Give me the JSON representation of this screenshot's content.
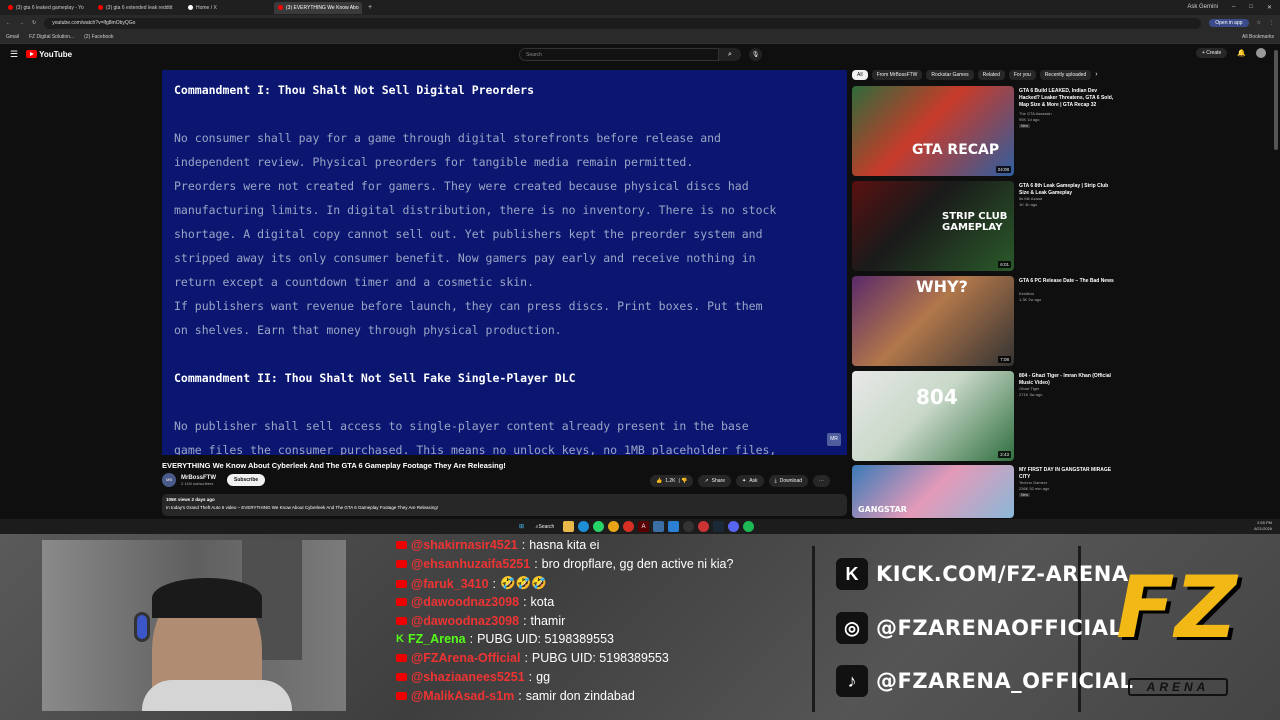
{
  "browser": {
    "tabs": [
      {
        "label": "(3) gta 6 leaked gameplay - Yo",
        "icon": "youtube-icon"
      },
      {
        "label": "(3) gta 6 extended leak redditt",
        "icon": "youtube-icon"
      },
      {
        "label": "Home / X",
        "icon": "x-icon"
      },
      {
        "label": "(3) EVERYTHING We Know Abo",
        "icon": "youtube-icon",
        "active": true
      }
    ],
    "url": "youtube.com/watch?v=lfg8mObyQGo",
    "open_in_app": "Open in app",
    "ask_gemini": "Ask Gemini",
    "bookmarks": [
      "Gmail",
      "FZ Digital Solution...",
      "(2) Facebook"
    ],
    "all_bookmarks": "All Bookmarks"
  },
  "youtube": {
    "logo": "YouTube",
    "logo_country": "PK",
    "search_placeholder": "Search",
    "create_label": "Create",
    "notif_count": "9+"
  },
  "player": {
    "lines": [
      {
        "text": "Commandment I: Thou Shalt Not Sell Digital Preorders",
        "heading": true
      },
      {
        "text": "No consumer shall pay for a game through digital storefronts before release and"
      },
      {
        "text": "independent review. Physical preorders for tangible media remain permitted."
      },
      {
        "text": "Preorders were not created for gamers. They were created because physical discs had"
      },
      {
        "text": "manufacturing limits. In digital distribution, there is no inventory. There is no stock"
      },
      {
        "text": "shortage. A digital copy cannot sell out. Yet publishers kept the preorder system and"
      },
      {
        "text": "stripped away its only consumer benefit. Now gamers pay early and receive nothing in"
      },
      {
        "text": "return except a countdown timer and a cosmetic skin."
      },
      {
        "text": "If publishers want revenue before launch, they can press discs. Print boxes. Put them"
      },
      {
        "text": "on shelves. Earn that money through physical production."
      },
      {
        "text": "Commandment II: Thou Shalt Not Sell Fake Single-Player DLC",
        "heading": true
      },
      {
        "text": "No publisher shall sell access to single-player content already present in the base"
      },
      {
        "text": "game files the consumer purchased. This means no unlock keys, no 1MB placeholder files,"
      }
    ],
    "badge": "MR"
  },
  "video": {
    "title": "EVERYTHING We Know About Cyberleek And The GTA 6 Gameplay Footage They Are Releasing!",
    "channel": "MrBossFTW",
    "subscribers": "2.11M subscribers",
    "subscribe": "Subscribe",
    "likes": "1.2K",
    "share": "Share",
    "ask": "Ask",
    "download": "Download",
    "meta": "105K views  2 days ago",
    "description": "In today's Grand Theft Auto 6 video – EVERYTHING We Know About Cyberleek And The GTA 6 Gameplay Footage They Are Releasing!"
  },
  "chips": [
    "All",
    "From MrBossFTW",
    "Rockstar Games",
    "Related",
    "For you",
    "Recently uploaded"
  ],
  "recommendations": [
    {
      "title": "GTA 6 Build LEAKED, Indian Dev Hacked? Leaker Threatens, GTA 6 Sold, Map Size & More | GTA Recap 32",
      "channel": "The GTA Assassin",
      "views": "95K  1d ago",
      "new": "New",
      "duration": "24:08",
      "thumb_text": "GTA RECAP"
    },
    {
      "title": "GTA 6 8th Leak Gameplay | Strip Club Size & Leak Gameplay",
      "channel": "Its Mir Azaad",
      "views": "1K  4h ago",
      "new": "",
      "duration": "6:01",
      "thumb_text": "STRIP CLUB GAMEPLAY"
    },
    {
      "title": "GTA 6 PC Release Date – The Bad News",
      "channel": "Kenithat",
      "views": "1.3K  2w ago",
      "new": "",
      "duration": "7:08",
      "thumb_text": "WHY?"
    },
    {
      "title": "804 - Ghazi Tiger - Imran Khan (Official Music Video)",
      "channel": "Ghazi Tiger",
      "views": "271K  3w ago",
      "new": "",
      "duration": "2:43",
      "thumb_text": "804"
    },
    {
      "title": "MY FIRST DAY IN GANGSTAR MIRAGE CITY",
      "channel": "Techno Gamerz",
      "views": "236K  52 min ago",
      "new": "New",
      "duration": "",
      "thumb_text": "GANGSTAR"
    }
  ],
  "taskbar": {
    "search": "Search",
    "time": "2:55 PM",
    "date": "8/21/2026"
  },
  "chat": [
    {
      "user": "@shakirnasir4521",
      "text": "hasna kita ei",
      "kick": false
    },
    {
      "user": "@ehsanhuzaifa5251",
      "text": "bro dropflare, gg den active ni kia?",
      "kick": false
    },
    {
      "user": "@faruk_3410",
      "text": "🤣🤣🤣",
      "kick": false
    },
    {
      "user": "@dawoodnaz3098",
      "text": "kota",
      "kick": false
    },
    {
      "user": "@dawoodnaz3098",
      "text": "thamir",
      "kick": false
    },
    {
      "user": "FZ_Arena",
      "text": "PUBG UID: 5198389553",
      "kick": true
    },
    {
      "user": "@FZArena-Official",
      "text": "PUBG UID: 5198389553",
      "kick": false
    },
    {
      "user": "@shaziaanees5251",
      "text": "gg",
      "kick": false
    },
    {
      "user": "@MalikAsad-s1m",
      "text": "samir don zindabad",
      "kick": false
    }
  ],
  "socials": [
    {
      "icon": "kick-icon",
      "glyph": "K",
      "text": "KICK.COM/FZ-ARENA"
    },
    {
      "icon": "instagram-icon",
      "glyph": "◎",
      "text": "@FZARENAOFFICIAL"
    },
    {
      "icon": "tiktok-icon",
      "glyph": "♪",
      "text": "@FZARENA_OFFICIAL"
    }
  ],
  "brand": {
    "logo": "FZ",
    "word": "ARENA"
  }
}
